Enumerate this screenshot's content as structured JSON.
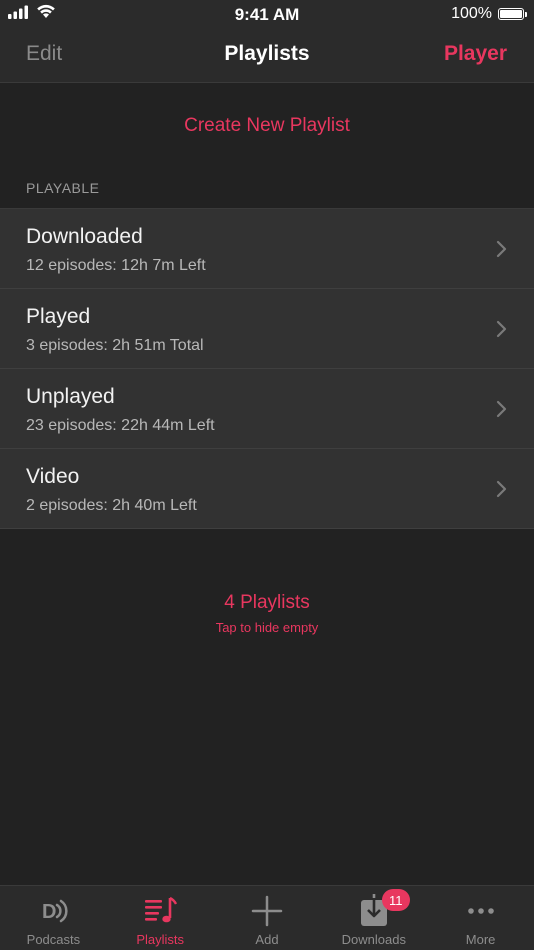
{
  "status": {
    "time": "9:41 AM",
    "battery_percent": "100%",
    "battery_level": 1.0
  },
  "nav": {
    "edit_label": "Edit",
    "title": "Playlists",
    "player_label": "Player"
  },
  "create_playlist_label": "Create New Playlist",
  "section_header": "PLAYABLE",
  "playlists": [
    {
      "title": "Downloaded",
      "subtitle": "12 episodes: 12h 7m Left"
    },
    {
      "title": "Played",
      "subtitle": "3 episodes: 2h 51m Total"
    },
    {
      "title": "Unplayed",
      "subtitle": "23 episodes: 22h 44m Left"
    },
    {
      "title": "Video",
      "subtitle": "2 episodes: 2h 40m Left"
    }
  ],
  "footer": {
    "count_label": "4 Playlists",
    "hint_label": "Tap to hide empty"
  },
  "tab_bar": {
    "items": [
      {
        "label": "Podcasts",
        "icon": "podcasts-icon"
      },
      {
        "label": "Playlists",
        "icon": "playlists-icon",
        "active": true
      },
      {
        "label": "Add",
        "icon": "add-icon"
      },
      {
        "label": "Downloads",
        "icon": "downloads-icon",
        "badge": "11"
      },
      {
        "label": "More",
        "icon": "more-icon"
      }
    ]
  },
  "colors": {
    "accent": "#e8375f",
    "background": "#222222",
    "row_background": "#323232",
    "bar_background": "#2b2b2b"
  }
}
